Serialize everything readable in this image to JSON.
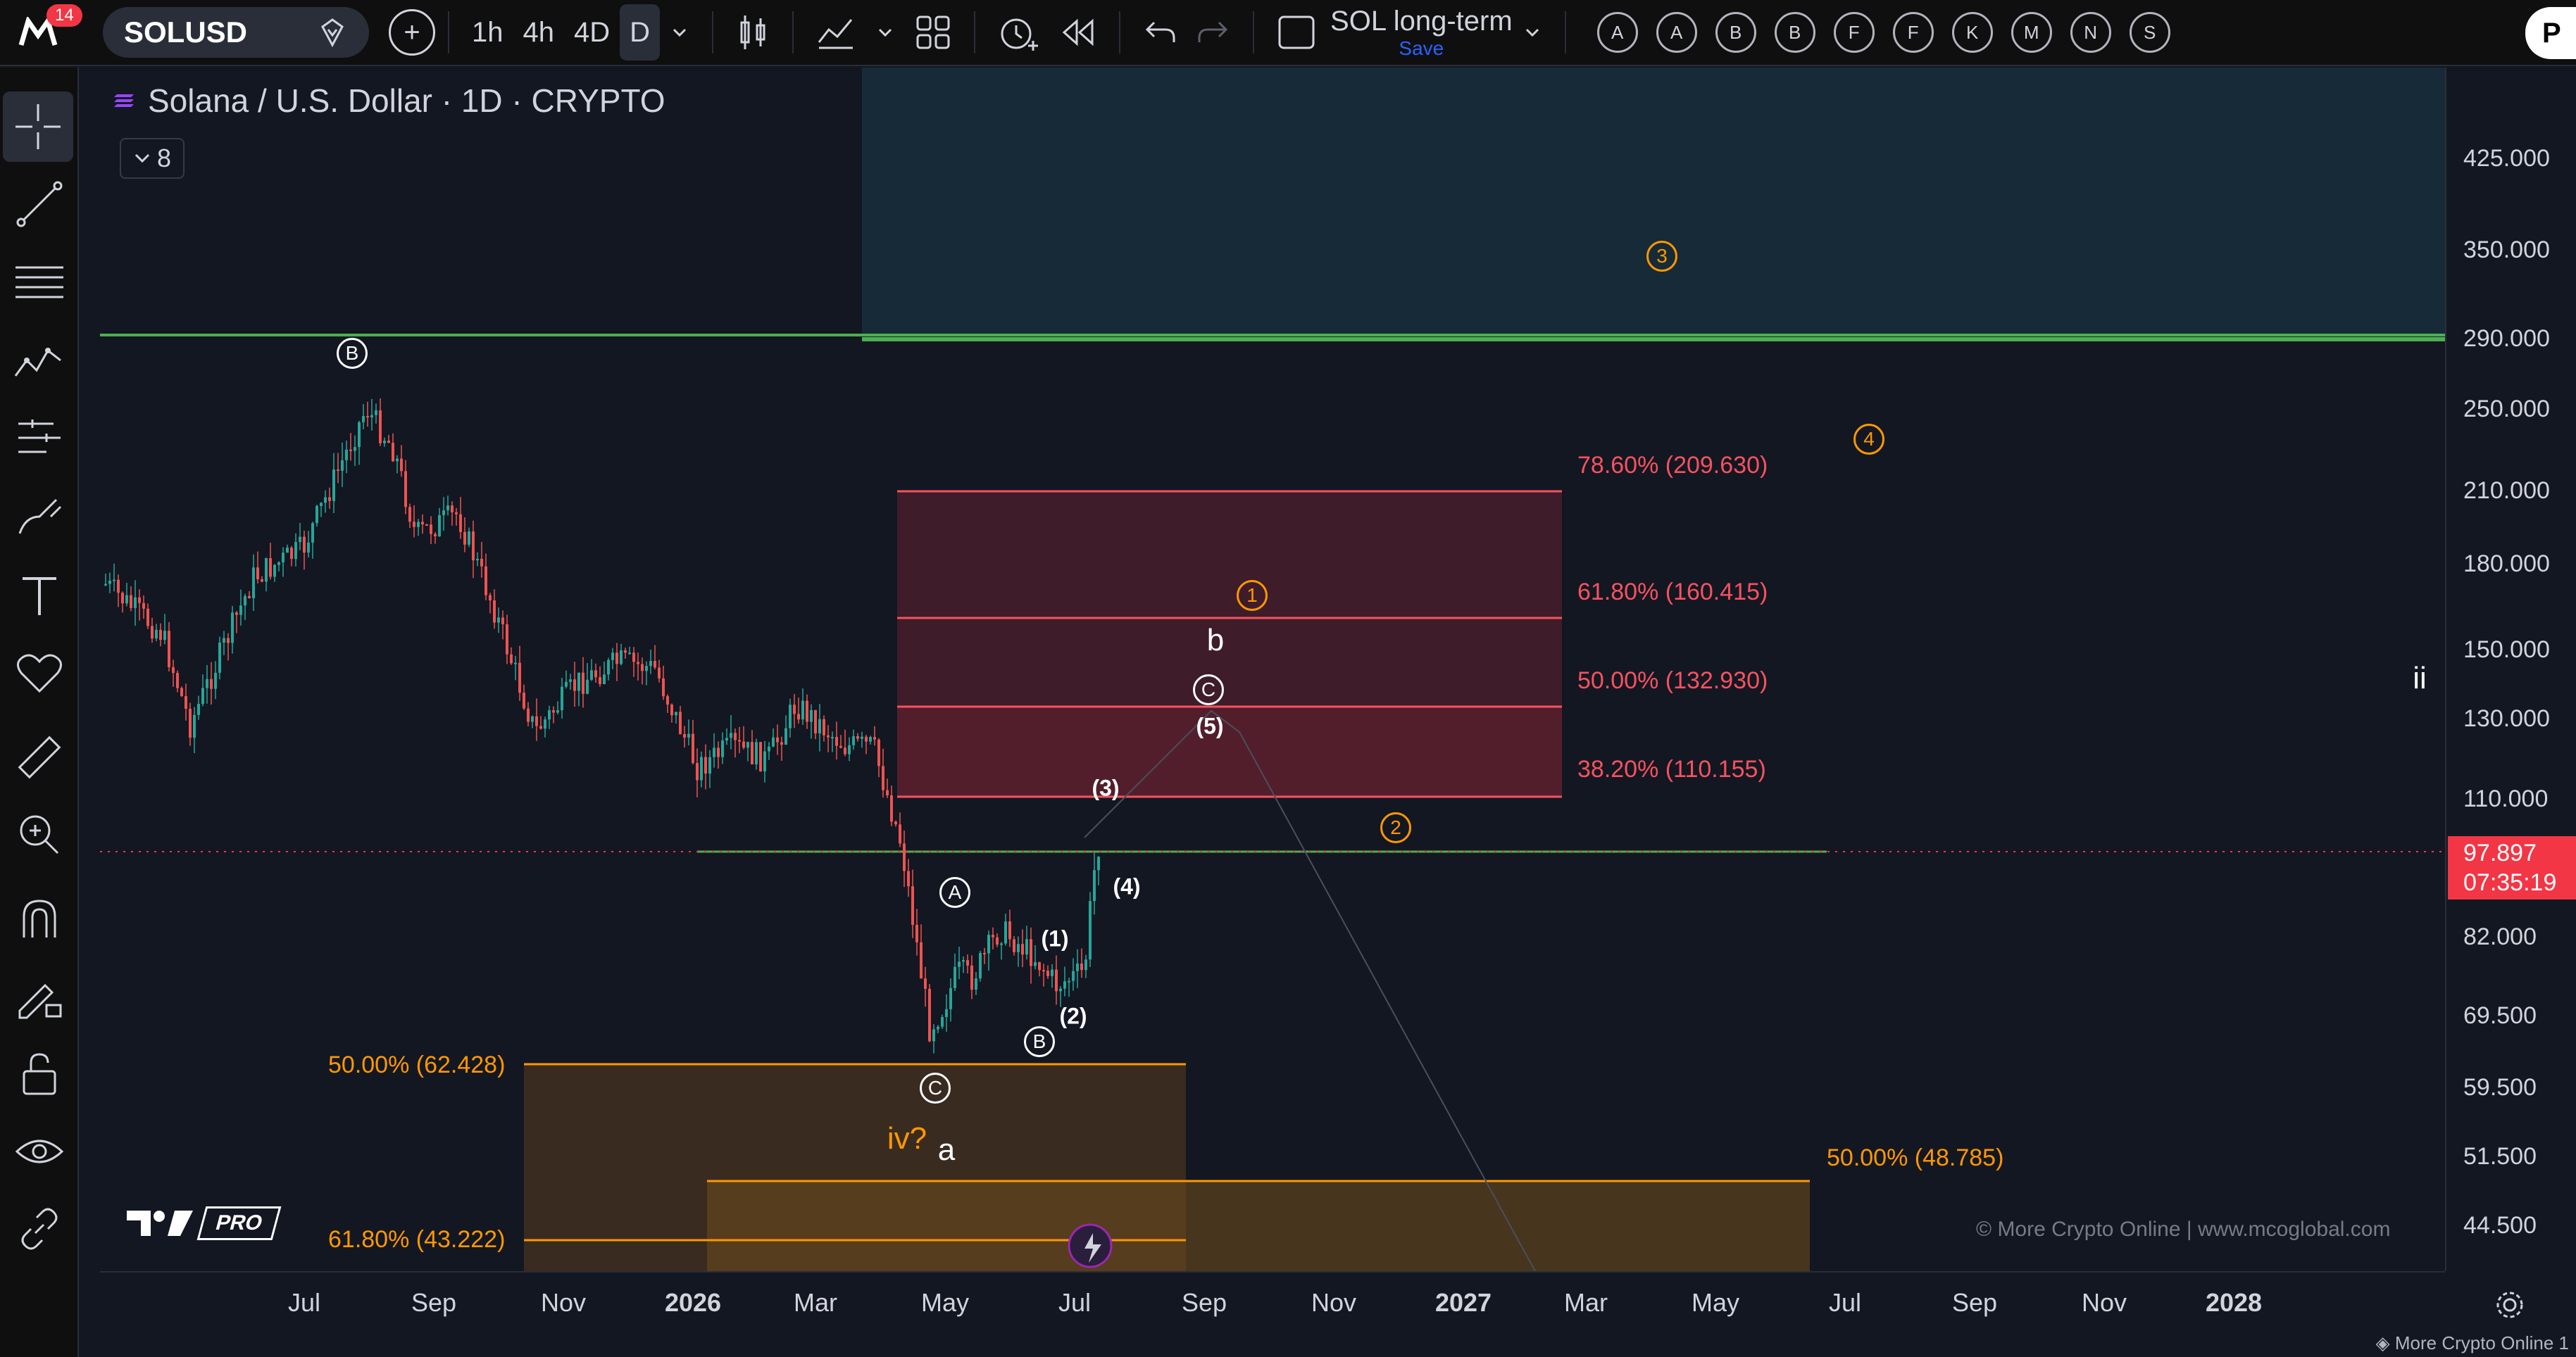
{
  "topbar": {
    "notification_count": "14",
    "symbol": "SOLUSD",
    "timeframes": [
      "1h",
      "4h",
      "4D",
      "D"
    ],
    "active_timeframe": "D",
    "layout_name": "SOL long-term",
    "layout_save": "Save",
    "alpha_buttons": [
      "A",
      "A",
      "B",
      "B",
      "F",
      "F",
      "K",
      "M",
      "N",
      "S"
    ],
    "publish_label": "P"
  },
  "legend": {
    "title": "Solana / U.S. Dollar · 1D · CRYPTO",
    "indicator_count": "8"
  },
  "price_axis": {
    "ticks": [
      "425.000",
      "350.000",
      "290.000",
      "250.000",
      "210.000",
      "180.000",
      "150.000",
      "130.000",
      "110.000",
      "82.000",
      "69.500",
      "59.500",
      "51.500",
      "44.500"
    ],
    "last_price": "97.897",
    "countdown": "07:35:19"
  },
  "time_axis": {
    "ticks": [
      "Jul",
      "Sep",
      "Nov",
      "2026",
      "Mar",
      "May",
      "Jul",
      "Sep",
      "Nov",
      "2027",
      "Mar",
      "May",
      "Jul",
      "Sep",
      "Nov",
      "2028"
    ],
    "bold_ticks": [
      "2026",
      "2027",
      "2028"
    ]
  },
  "fib_upper": [
    {
      "label": "78.60% (209.630)"
    },
    {
      "label": "61.80% (160.415)"
    },
    {
      "label": "50.00% (132.930)"
    },
    {
      "label": "38.20% (110.155)"
    }
  ],
  "fib_lower": [
    {
      "label": "50.00% (62.428)"
    },
    {
      "label": "61.80% (43.222)"
    },
    {
      "label": "50.00% (48.785)"
    }
  ],
  "waves": {
    "circled_white": [
      "B",
      "A",
      "C",
      "B",
      "C"
    ],
    "paren": [
      "(1)",
      "(2)",
      "(3)",
      "(4)",
      "(5)"
    ],
    "orange_circled": [
      "1",
      "2",
      "3",
      "4"
    ],
    "letters": {
      "b": "b",
      "a": "a",
      "iv": "iv?",
      "ii": "ii"
    }
  },
  "branding": {
    "pro": "PRO",
    "watermark": "© More Crypto Online  |  www.mcoglobal.com",
    "footer": "More Crypto Online 1"
  },
  "colors": {
    "background": "#131722",
    "up_candle": "#26a69a",
    "down_candle": "#ef5350",
    "fib_red": "#f7525f",
    "fib_orange": "#ff9800",
    "green_line": "#4caf50",
    "price_tag": "#f23645"
  }
}
